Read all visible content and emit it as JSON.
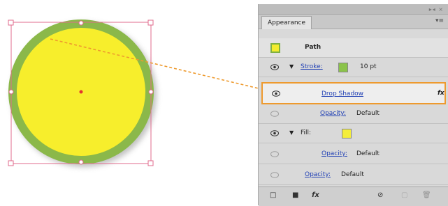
{
  "artwork": {
    "fill_color": "#f7ee2c",
    "stroke_color": "#8bb84a",
    "selection_color": "#e06b8c",
    "shadow_color": "#8a8a8a",
    "connector_color": "#ee9a2e"
  },
  "panel": {
    "tab_label": "Appearance",
    "menu_icon": "panel-menu-icon",
    "object_label": "Path",
    "stroke": {
      "label": "Stroke:",
      "swatch_color": "#8bc34a",
      "weight": "10 pt"
    },
    "effect": {
      "label": "Drop Shadow",
      "fx_symbol": "fx"
    },
    "opacity_stroke": {
      "label": "Opacity:",
      "value": "Default"
    },
    "fill": {
      "label": "Fill:",
      "swatch_color": "#f4ee3a"
    },
    "opacity_fill": {
      "label": "Opacity:",
      "value": "Default"
    },
    "opacity_object": {
      "label": "Opacity:",
      "value": "Default"
    },
    "bottom": {
      "add_stroke": "□",
      "add_fill": "■",
      "add_effect": "fx",
      "clear": "⊘",
      "duplicate": "▢",
      "delete": "🗑"
    }
  }
}
